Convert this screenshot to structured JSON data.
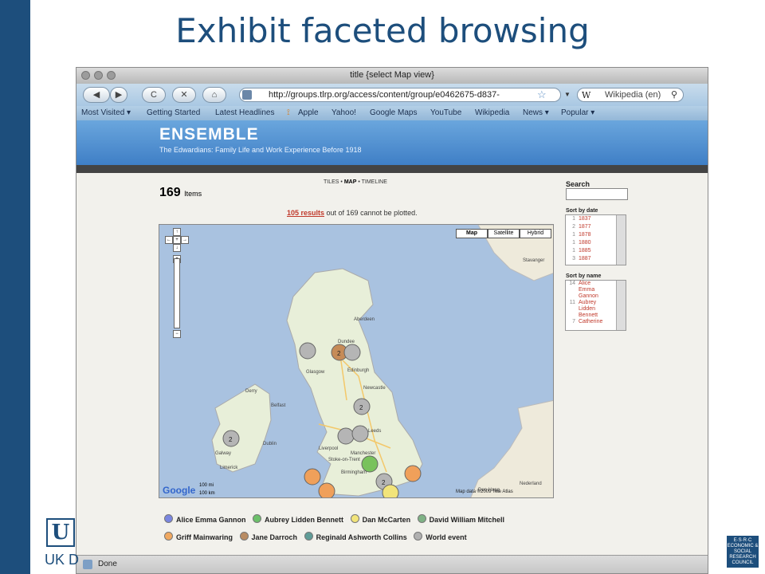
{
  "slide": {
    "title": "Exhibit faceted browsing",
    "footer_logo_text": "UK D",
    "footer_logo_letter": "U",
    "esrc_text": "E·S·R·C ECONOMIC & SOCIAL RESEARCH COUNCIL"
  },
  "colors": {
    "accent": "#1d4e7c",
    "ensemble_header": "#4f8fd2",
    "red_link": "#c0392b"
  },
  "browser": {
    "window_title": "title {select Map view}",
    "url": "http://groups.tlrp.org/access/content/group/e0462675-d837-",
    "search_placeholder": "Wikipedia (en)",
    "buttons": {
      "back": "◀",
      "forward": "▶",
      "reload": "C",
      "stop": "✕",
      "home": "⌂"
    },
    "bookmarks": [
      "Most Visited ▾",
      "Getting Started",
      "Latest Headlines",
      "Apple",
      "Yahoo!",
      "Google Maps",
      "YouTube",
      "Wikipedia",
      "News ▾",
      "Popular ▾"
    ],
    "status": "Done"
  },
  "ensemble": {
    "title": "ENSEMBLE",
    "subtitle": "The Edwardians: Family Life and Work Experience Before 1918"
  },
  "view_tabs": {
    "tiles": "TILES",
    "map": "MAP",
    "timeline": "TIMELINE",
    "sep": "•"
  },
  "results": {
    "count": "169",
    "count_label": "Items",
    "unplotted_link": "105 results",
    "unplotted_rest": " out of 169 cannot be plotted."
  },
  "map": {
    "types": [
      "Map",
      "Satellite",
      "Hybrid"
    ],
    "selected_type": "Map",
    "attribution": "Map data ©2009 Tele Atlas",
    "scale_top": "100 mi",
    "scale_bottom": "100 km",
    "google": "Google",
    "places": [
      "Aberdeen",
      "Dundee",
      "Edinburgh",
      "Glasgow",
      "Newcastle",
      "Belfast",
      "Derry",
      "Dublin",
      "Galway",
      "Limerick",
      "Manchester",
      "Liverpool",
      "Leeds",
      "Birmingham",
      "Stoke-on-Trent",
      "Nederland",
      "Stavanger",
      "Den Haag"
    ],
    "markers": [
      {
        "label": "",
        "color": "gray"
      },
      {
        "label": "2",
        "color": "brown"
      },
      {
        "label": "",
        "color": "gray"
      },
      {
        "label": "2",
        "color": "gray"
      },
      {
        "label": "2",
        "color": "gray"
      },
      {
        "label": "",
        "color": "gray"
      },
      {
        "label": "",
        "color": "gray"
      },
      {
        "label": "",
        "color": "green"
      },
      {
        "label": "",
        "color": "orange"
      },
      {
        "label": "",
        "color": "orange"
      },
      {
        "label": "2",
        "color": "gray"
      },
      {
        "label": "",
        "color": "yellow"
      },
      {
        "label": "",
        "color": "orange"
      }
    ]
  },
  "legend": [
    {
      "name": "Alice Emma Gannon",
      "color": "#7a86e0"
    },
    {
      "name": "Aubrey Lidden Bennett",
      "color": "#6cc06a"
    },
    {
      "name": "Dan McCarten",
      "color": "#f2e47a"
    },
    {
      "name": "David William Mitchell",
      "color": "#7fb285"
    },
    {
      "name": "Griff Mainwaring",
      "color": "#f0a860"
    },
    {
      "name": "Jane Darroch",
      "color": "#b98c63"
    },
    {
      "name": "Reginald Ashworth Collins",
      "color": "#5f9c97"
    },
    {
      "name": "World event",
      "color": "#b0b0b0"
    }
  ],
  "sidebar": {
    "search_label": "Search",
    "sort_by_date_label": "Sort by date",
    "dates": [
      {
        "count": "1",
        "value": "1837"
      },
      {
        "count": "2",
        "value": "1877"
      },
      {
        "count": "1",
        "value": "1878"
      },
      {
        "count": "1",
        "value": "1880"
      },
      {
        "count": "1",
        "value": "1885"
      },
      {
        "count": "3",
        "value": "1887"
      }
    ],
    "sort_by_name_label": "Sort by name",
    "names": [
      {
        "count": "14",
        "value": "Alice"
      },
      {
        "count": "",
        "value": "Emma"
      },
      {
        "count": "",
        "value": "Gannon"
      },
      {
        "count": "11",
        "value": "Aubrey"
      },
      {
        "count": "",
        "value": "Lidden"
      },
      {
        "count": "",
        "value": "Bennett"
      },
      {
        "count": "7",
        "value": "Catherine"
      }
    ]
  }
}
